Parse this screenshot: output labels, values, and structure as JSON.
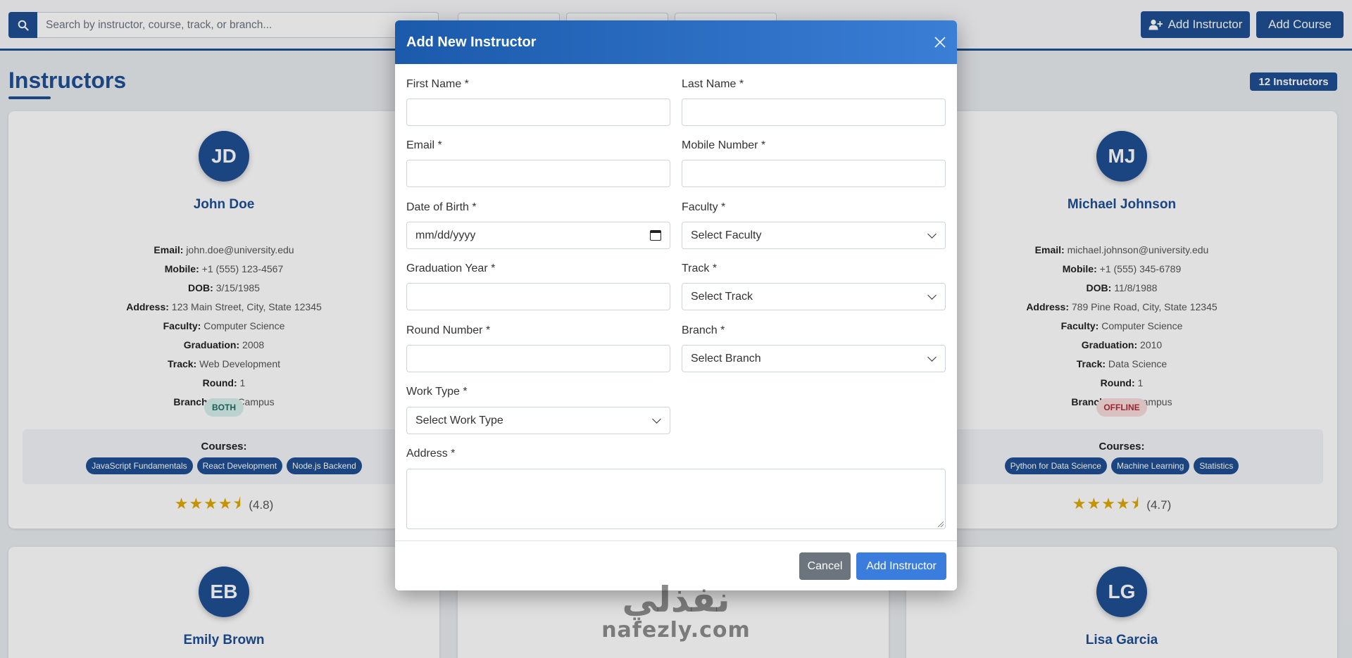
{
  "search": {
    "placeholder": "Search by instructor, course, track, or branch..."
  },
  "header": {
    "add_instructor_label": "Add Instructor",
    "add_course_label": "Add Course"
  },
  "page": {
    "title": "Instructors",
    "count_badge": "12 Instructors"
  },
  "field_labels": {
    "email": "Email:",
    "mobile": "Mobile:",
    "dob": "DOB:",
    "address": "Address:",
    "faculty": "Faculty:",
    "graduation": "Graduation:",
    "track": "Track:",
    "round": "Round:",
    "branch": "Branch:"
  },
  "courses_label": "Courses:",
  "cards": [
    {
      "initials": "JD",
      "name": "John Doe",
      "email": "john.doe@university.edu",
      "mobile": "+1 (555) 123-4567",
      "dob": "3/15/1985",
      "address": "123 Main Street, City, State 12345",
      "faculty": "Computer Science",
      "graduation": "2008",
      "track": "Web Development",
      "round": "1",
      "branch": "Main Campus",
      "work_type": "BOTH",
      "courses": [
        "JavaScript Fundamentals",
        "React Development",
        "Node.js Backend"
      ],
      "rating": "(4.8)"
    },
    {
      "initials": "MJ",
      "name": "Michael Johnson",
      "email": "michael.johnson@university.edu",
      "mobile": "+1 (555) 345-6789",
      "dob": "11/8/1988",
      "address": "789 Pine Road, City, State 12345",
      "faculty": "Computer Science",
      "graduation": "2010",
      "track": "Data Science",
      "round": "1",
      "branch": "Main Campus",
      "work_type": "OFFLINE",
      "courses": [
        "Python for Data Science",
        "Machine Learning",
        "Statistics"
      ],
      "rating": "(4.7)"
    },
    {
      "initials": "EB",
      "name": "Emily Brown"
    },
    {
      "initials": "LG",
      "name": "Lisa Garcia"
    }
  ],
  "modal": {
    "title": "Add New Instructor",
    "labels": {
      "first_name": "First Name *",
      "last_name": "Last Name *",
      "email": "Email *",
      "mobile": "Mobile Number *",
      "dob": "Date of Birth *",
      "faculty": "Faculty *",
      "graduation_year": "Graduation Year *",
      "track": "Track *",
      "round_number": "Round Number *",
      "branch": "Branch *",
      "work_type": "Work Type *",
      "address": "Address *"
    },
    "values": {
      "dob_placeholder": "mm/dd/yyyy",
      "faculty_select": "Select Faculty",
      "track_select": "Select Track",
      "branch_select": "Select Branch",
      "work_type_select": "Select Work Type"
    },
    "cancel_label": "Cancel",
    "submit_label": "Add Instructor"
  },
  "watermark": {
    "arabic": "نفذلي",
    "latin": "nafezly.com"
  }
}
